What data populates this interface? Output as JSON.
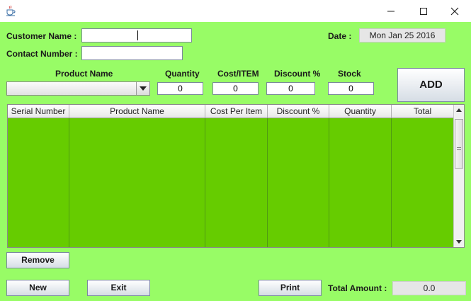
{
  "window": {
    "icon": "java-cup-icon",
    "controls": [
      "minimize-icon",
      "maximize-icon",
      "close-icon"
    ]
  },
  "customer": {
    "name_label": "Customer Name :",
    "name_value": "",
    "contact_label": "Contact Number :",
    "contact_value": ""
  },
  "date": {
    "label": "Date :",
    "value": "Mon Jan 25 2016"
  },
  "entry": {
    "product_label": "Product Name",
    "product_selected": "",
    "quantity_label": "Quantity",
    "quantity_value": "0",
    "cost_label": "Cost/ITEM",
    "cost_value": "0",
    "discount_label": "Discount %",
    "discount_value": "0",
    "stock_label": "Stock",
    "stock_value": "0",
    "add_label": "ADD"
  },
  "table": {
    "columns": [
      "Serial Number",
      "Product Name",
      "Cost Per Item",
      "Discount %",
      "Quantity",
      "Total"
    ],
    "rows": []
  },
  "buttons": {
    "remove": "Remove",
    "new": "New",
    "exit": "Exit",
    "print": "Print"
  },
  "total": {
    "label": "Total Amount :",
    "value": "0.0"
  },
  "colors": {
    "background": "#98FC66",
    "table_body": "#66CC00"
  }
}
